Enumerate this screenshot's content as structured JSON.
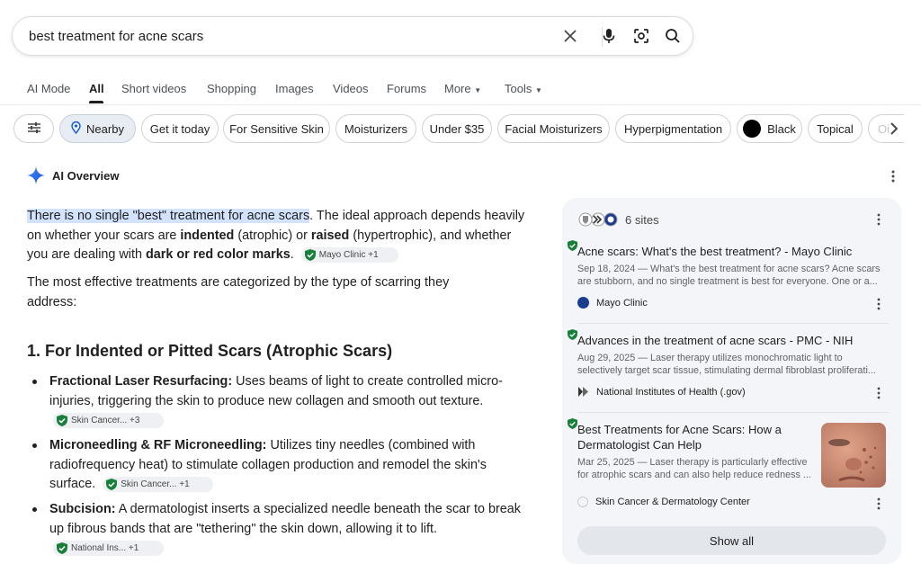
{
  "search": {
    "query": "best treatment for acne scars"
  },
  "tabs": [
    {
      "label": "AI Mode"
    },
    {
      "label": "All"
    },
    {
      "label": "Short videos"
    },
    {
      "label": "Shopping"
    },
    {
      "label": "Images"
    },
    {
      "label": "Videos"
    },
    {
      "label": "Forums"
    },
    {
      "label": "More"
    },
    {
      "label": "Tools"
    }
  ],
  "chips": [
    {
      "label": "Nearby"
    },
    {
      "label": "Get it today"
    },
    {
      "label": "For Sensitive Skin"
    },
    {
      "label": "Moisturizers"
    },
    {
      "label": "Under $35"
    },
    {
      "label": "Facial Moisturizers"
    },
    {
      "label": "Hyperpigmentation"
    },
    {
      "label": "Black"
    },
    {
      "label": "Topical"
    },
    {
      "label": "Oi"
    }
  ],
  "overview": {
    "title": "AI Overview",
    "p1": {
      "highlight": "There is no single \"best\" treatment for acne scars",
      "t1": ". The ideal approach depends heavily on whether your scars are ",
      "b1": "indented",
      "t2": " (atrophic) or ",
      "b2": "raised",
      "t3": " (hypertrophic), and whether you are dealing with ",
      "b3": "dark or red color marks",
      "t4": ".",
      "cite": "Mayo Clinic +1"
    },
    "p2": "The most effective treatments are categorized by the type of scarring they address:",
    "heading": "1. For Indented or Pitted Scars (Atrophic Scars)",
    "items": [
      {
        "bold": "Fractional Laser Resurfacing:",
        "text": " Uses beams of light to create controlled micro-injuries, triggering the skin to produce new collagen and smooth out texture.",
        "cite": "Skin Cancer... +3"
      },
      {
        "bold": "Microneedling & RF Microneedling:",
        "text": " Utilizes tiny needles (combined with radiofrequency heat) to stimulate collagen production and remodel the skin's surface.",
        "cite": "Skin Cancer... +1"
      },
      {
        "bold": "Subcision:",
        "text": " A dermatologist inserts a specialized needle beneath the scar to break up fibrous bands that are \"tethering\" the skin down, allowing it to lift.",
        "cite": "National Ins... +1"
      }
    ]
  },
  "sources": {
    "count_label": "6 sites",
    "items": [
      {
        "title": "Acne scars: What's the best treatment? - Mayo Clinic",
        "snippet": "Sep 18, 2024 — What's the best treatment for acne scars? Acne scars are stubborn, and no single treatment is best for everyone. One or a...",
        "site": "Mayo Clinic"
      },
      {
        "title": "Advances in the treatment of acne scars - PMC - NIH",
        "snippet": "Aug 29, 2025 — Laser therapy utilizes monochromatic light to selectively target scar tissue, stimulating dermal fibroblast proliferati...",
        "site": "National Institutes of Health (.gov)"
      },
      {
        "title": "Best Treatments for Acne Scars: How a Dermatologist Can Help",
        "snippet": "Mar 25, 2025 — Laser therapy is particularly effective for atrophic scars and can also help reduce redness ...",
        "site": "Skin Cancer & Dermatology Center"
      }
    ],
    "show_all": "Show all"
  },
  "colors": {
    "accent": "#0b57d0",
    "highlight": "#d3e3fd",
    "verified": "#188038"
  }
}
